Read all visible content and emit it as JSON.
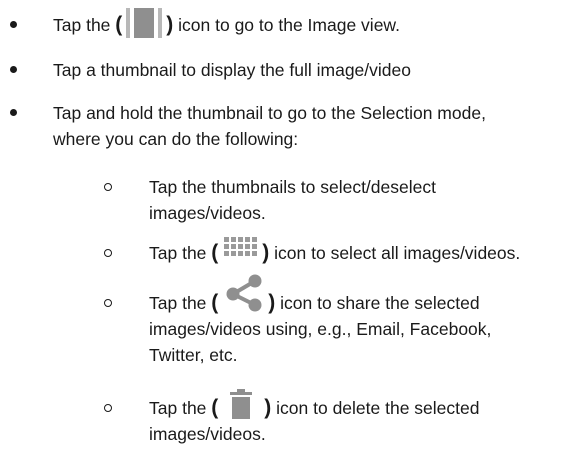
{
  "items": [
    {
      "text_before": "Tap the",
      "text_after": "icon to go to the Image view.",
      "icon": "image-view-icon"
    },
    {
      "text": "Tap a thumbnail to display the full image/video"
    },
    {
      "line1": "Tap and hold the thumbnail to go to the Selection mode,",
      "line2": "where you can do the following:"
    }
  ],
  "subitems": [
    {
      "line1": "Tap the thumbnails to select/deselect",
      "line2": "images/videos."
    },
    {
      "text_before": "Tap the",
      "text_after": "icon to select all images/videos.",
      "icon": "select-all-grid-icon"
    },
    {
      "text_before": "Tap the",
      "line1_after": "icon to share the selected",
      "line2": "images/videos using, e.g., Email, Facebook,",
      "line3": "Twitter, etc.",
      "icon": "share-icon"
    },
    {
      "text_before": "Tap the",
      "line1_after": "icon to delete the selected",
      "line2": "images/videos.",
      "icon": "trash-icon"
    }
  ],
  "paren_open": "(",
  "paren_close": ")",
  "colors": {
    "text": "#1a1a1a",
    "icon_gray": "#8f8f8f",
    "icon_light": "#b8b8b8"
  }
}
